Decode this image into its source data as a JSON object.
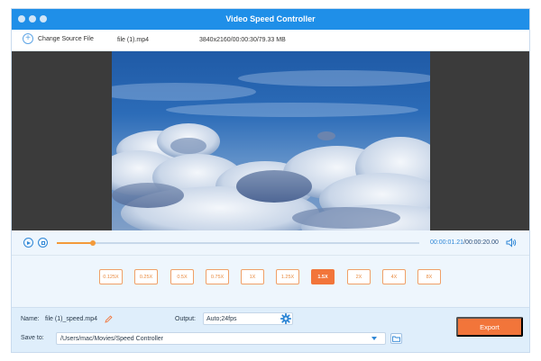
{
  "window": {
    "title": "Video Speed Controller"
  },
  "file_bar": {
    "change_source_label": "Change Source File",
    "file_name": "file (1).mp4",
    "file_info": "3840x2160/00:00:30/79.33 MB"
  },
  "player": {
    "current_time": "00:00:01.21",
    "separator": "/",
    "total_time": "00:00:20.00",
    "progress": 0.1
  },
  "speeds": {
    "options": [
      "0.125X",
      "0.25X",
      "0.5X",
      "0.75X",
      "1X",
      "1.25X",
      "1.5X",
      "2X",
      "4X",
      "8X"
    ],
    "selected": "1.5X"
  },
  "output": {
    "name_label": "Name:",
    "name_value": "file (1)_speed.mp4",
    "output_label": "Output:",
    "output_value": "Auto;24fps",
    "save_label": "Save to:",
    "save_path": "/Users/mac/Movies/Speed Controller",
    "export_label": "Export"
  },
  "colors": {
    "accent": "#1f8fe8",
    "export": "#f2753a",
    "speed_border": "#f0a067"
  }
}
